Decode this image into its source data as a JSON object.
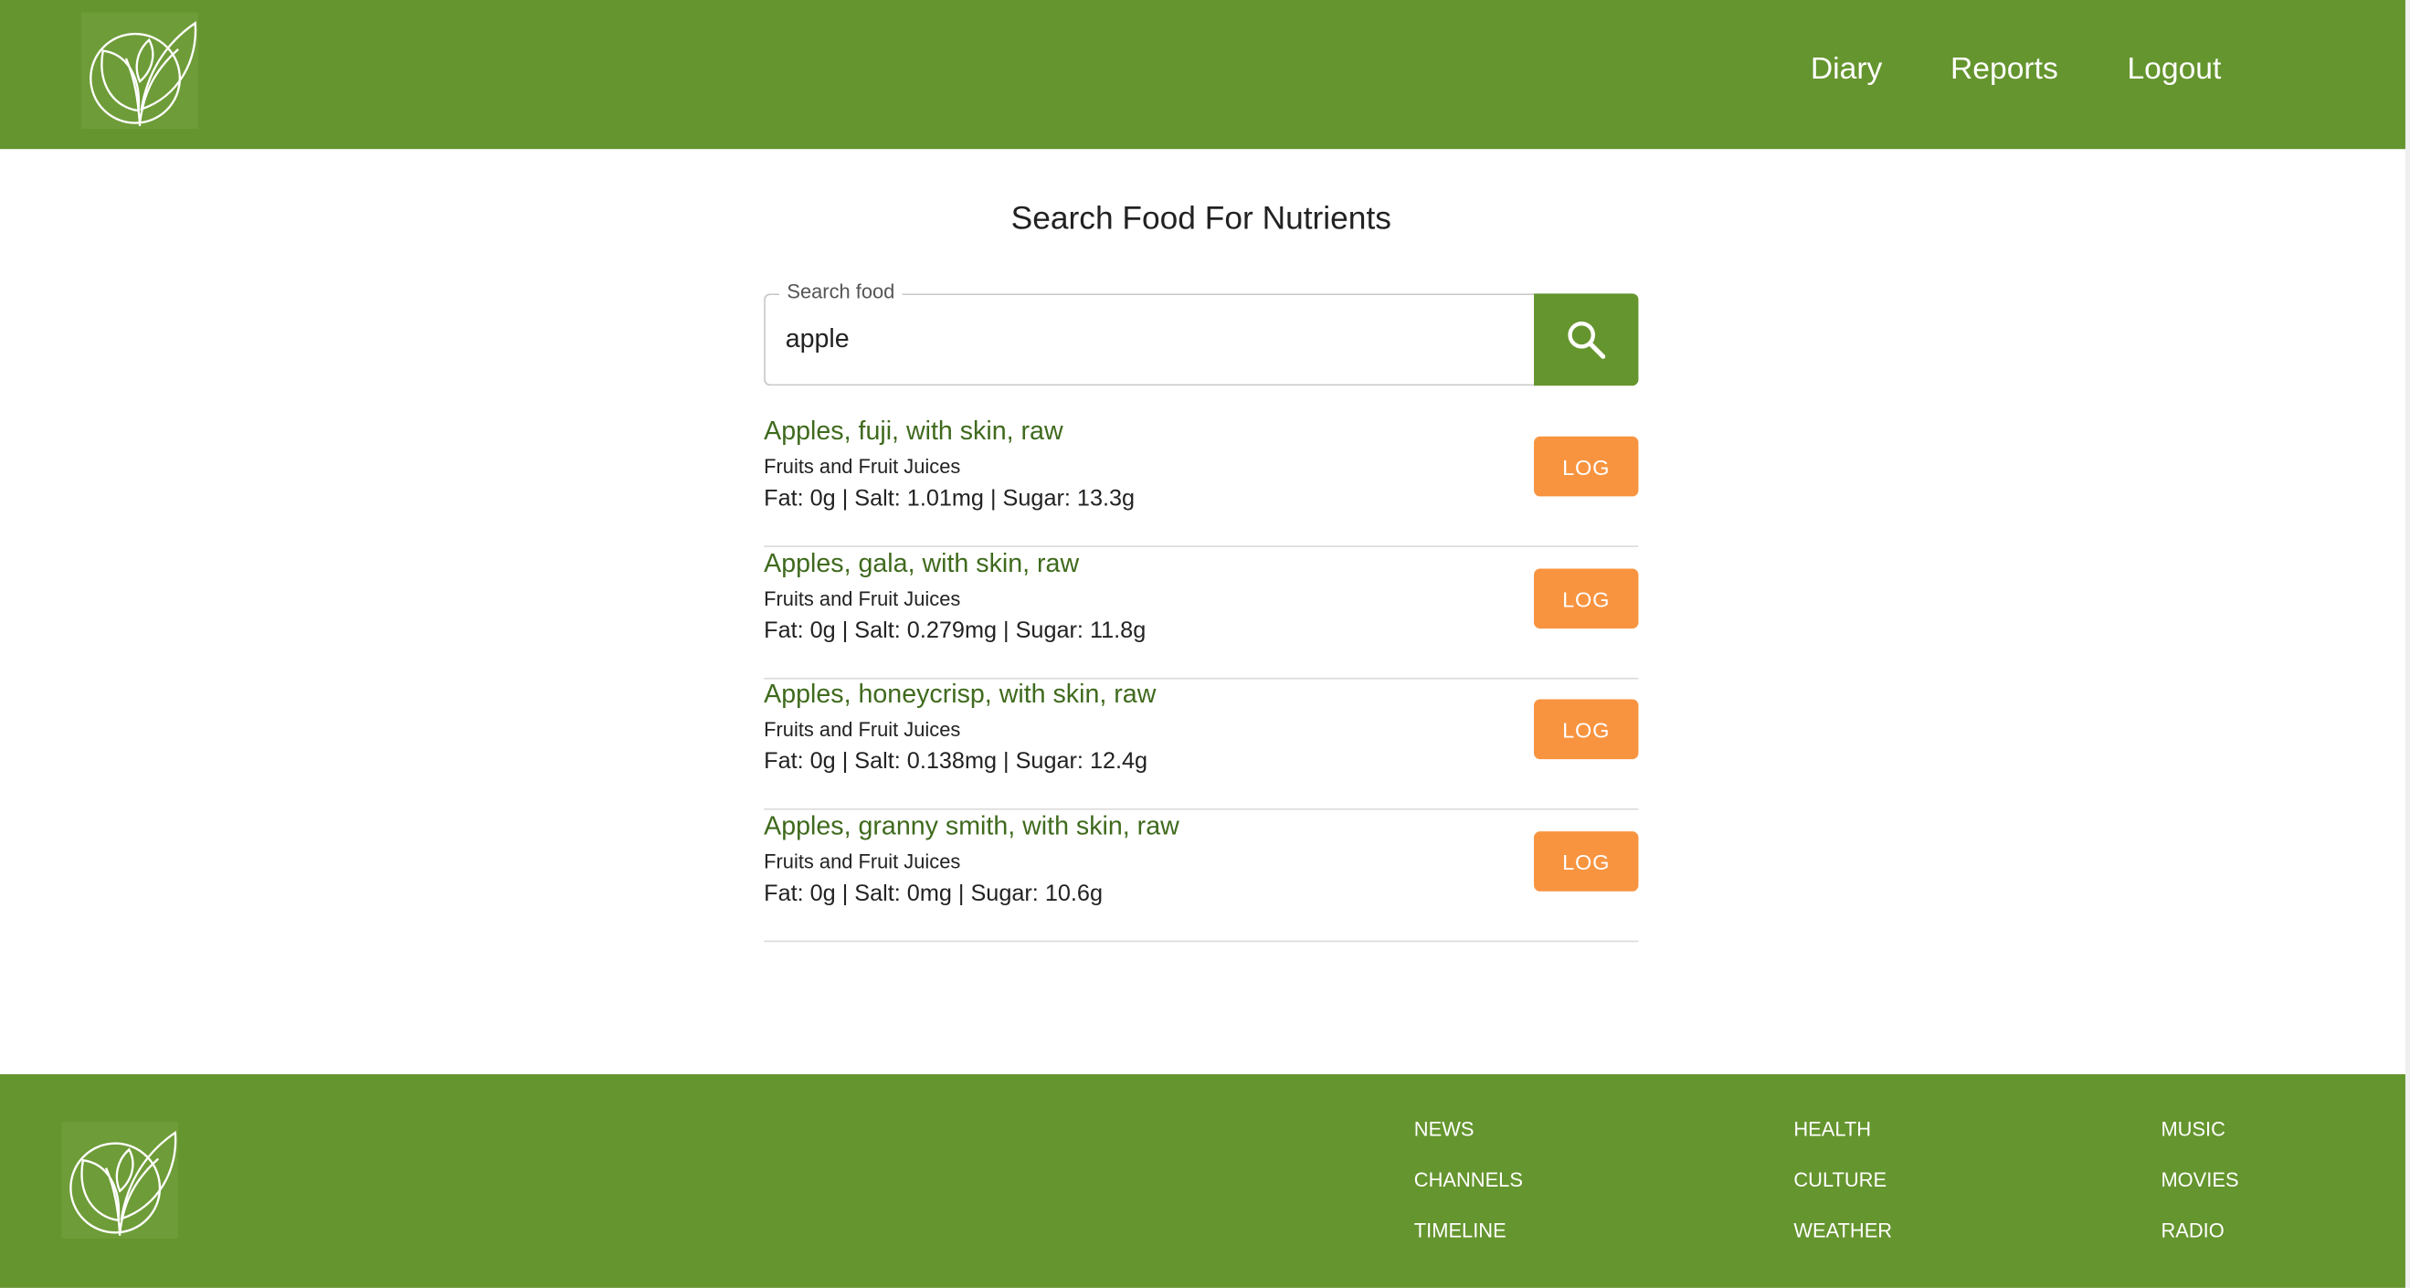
{
  "header": {
    "logo_icon": "leaf-logo-icon",
    "nav": {
      "diary": "Diary",
      "reports": "Reports",
      "logout": "Logout"
    }
  },
  "main": {
    "title": "Search Food For Nutrients",
    "search": {
      "label": "Search food",
      "value": "apple",
      "button_icon": "search-icon"
    },
    "results": [
      {
        "name": "Apples, fuji, with skin, raw",
        "category": "Fruits and Fruit Juices",
        "nutrients": "Fat: 0g | Salt: 1.01mg | Sugar: 13.3g",
        "action": "LOG"
      },
      {
        "name": "Apples, gala, with skin, raw",
        "category": "Fruits and Fruit Juices",
        "nutrients": "Fat: 0g | Salt: 0.279mg | Sugar: 11.8g",
        "action": "LOG"
      },
      {
        "name": "Apples, honeycrisp, with skin, raw",
        "category": "Fruits and Fruit Juices",
        "nutrients": "Fat: 0g | Salt: 0.138mg | Sugar: 12.4g",
        "action": "LOG"
      },
      {
        "name": "Apples, granny smith, with skin, raw",
        "category": "Fruits and Fruit Juices",
        "nutrients": "Fat: 0g | Salt: 0mg | Sugar: 10.6g",
        "action": "LOG"
      }
    ]
  },
  "footer": {
    "logo_icon": "leaf-logo-icon",
    "columns": [
      [
        "NEWS",
        "CHANNELS",
        "TIMELINE"
      ],
      [
        "HEALTH",
        "CULTURE",
        "WEATHER"
      ],
      [
        "MUSIC",
        "MOVIES",
        "RADIO"
      ]
    ]
  },
  "colors": {
    "brand_green": "#65952e",
    "result_title_green": "#3f6a1d",
    "log_orange": "#f89440"
  }
}
